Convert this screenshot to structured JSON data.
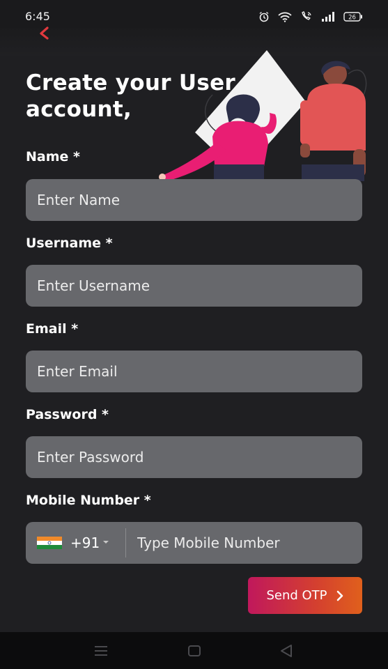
{
  "status_bar": {
    "time": "6:45",
    "battery": "26"
  },
  "header": {
    "title_line1": "Create your User",
    "title_line2": "account,"
  },
  "form": {
    "name": {
      "label": "Name *",
      "placeholder": "Enter Name",
      "value": ""
    },
    "username": {
      "label": "Username *",
      "placeholder": "Enter Username",
      "value": ""
    },
    "email": {
      "label": "Email *",
      "placeholder": "Enter Email",
      "value": ""
    },
    "password": {
      "label": "Password *",
      "placeholder": "Enter Password",
      "value": ""
    },
    "mobile": {
      "label": "Mobile Number *",
      "country_code": "+91",
      "placeholder": "Type Mobile Number",
      "value": ""
    }
  },
  "actions": {
    "send_otp_label": "Send OTP"
  },
  "icons": {
    "back": "chevron-left-icon",
    "send": "chevron-right-icon",
    "flag": "india-flag-icon",
    "nav": [
      "menu-icon",
      "home-square-icon",
      "back-triangle-icon"
    ]
  },
  "colors": {
    "background": "#1f1f22",
    "input_background": "#67686c",
    "accent_back": "#e0393e",
    "button_gradient_start": "#c0185c",
    "button_gradient_end": "#e0601c"
  }
}
